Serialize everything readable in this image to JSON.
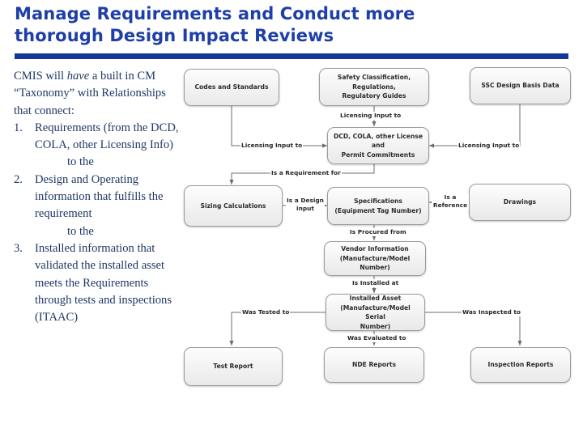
{
  "slide": {
    "title": "Manage Requirements and Conduct more thorough Design Impact Reviews",
    "title_line1": "Manage Requirements and Conduct more",
    "title_line2": "thorough Design Impact Reviews",
    "title_color": "#1F3FA8",
    "rule_color": "#14379B",
    "background": "#FFFFFF"
  },
  "narrative": {
    "text_color": "#1F3864",
    "intro_part1": "CMIS will ",
    "intro_emphasis": "have",
    "intro_part2": " a built in CM “Taxonomy”  with Relationships  that connect:",
    "items": [
      {
        "number": "1.",
        "text": "Requirements (from the DCD, COLA, other Licensing Info)",
        "connector": "to the"
      },
      {
        "number": "2.",
        "text": "Design and Operating information that fulfills the requirement",
        "connector": "to the"
      },
      {
        "number": "3.",
        "text": "Installed information that validated the installed asset meets the Requirements through tests and inspections (ITAAC)",
        "connector": ""
      }
    ]
  },
  "diagram": {
    "nodes": [
      {
        "id": "codes",
        "label": "Codes and Standards"
      },
      {
        "id": "safety",
        "label_line1": "Safety Classification, Regulations,",
        "label_line2": "Regulatory Guides"
      },
      {
        "id": "ssc",
        "label": "SSC Design Basis Data"
      },
      {
        "id": "dcd",
        "label_line1": "DCD, COLA, other License and",
        "label_line2": "Permit Commitments"
      },
      {
        "id": "sizing",
        "label": "Sizing Calculations"
      },
      {
        "id": "specs",
        "label_line1": "Specifications",
        "label_line2": "(Equipment Tag Number)"
      },
      {
        "id": "drawings",
        "label": "Drawings"
      },
      {
        "id": "vendor",
        "label_line1": "Vendor Information",
        "label_line2": "(Manufacture/Model Number)"
      },
      {
        "id": "asset",
        "label_line1": "Installed Asset",
        "label_line2": "(Manufacture/Model Serial",
        "label_line3": "Number)"
      },
      {
        "id": "testreport",
        "label": "Test Report"
      },
      {
        "id": "nde",
        "label": "NDE Reports"
      },
      {
        "id": "inspection",
        "label": "Inspection Reports"
      }
    ],
    "edges": [
      {
        "id": "codes-dcd",
        "label": "Licensing Input to"
      },
      {
        "id": "safety-dcd",
        "label": "Licensing Input to"
      },
      {
        "id": "ssc-dcd",
        "label": "Licensing Input to"
      },
      {
        "id": "dcd-sizing",
        "label": "Is a Requirement for"
      },
      {
        "id": "sizing-specs",
        "label_line1": "Is a Design",
        "label_line2": "input"
      },
      {
        "id": "drawings-specs",
        "label_line1": "Is a",
        "label_line2": "Reference"
      },
      {
        "id": "specs-vendor",
        "label": "Is Procured from"
      },
      {
        "id": "vendor-asset",
        "label": "Is Installed at"
      },
      {
        "id": "asset-testreport",
        "label": "Was Tested to"
      },
      {
        "id": "asset-nde",
        "label": "Was Evaluated to"
      },
      {
        "id": "asset-inspection",
        "label": "Was Inspected to"
      }
    ],
    "line_color": "#6E6E6E",
    "node_border": "#9B9B9B"
  }
}
